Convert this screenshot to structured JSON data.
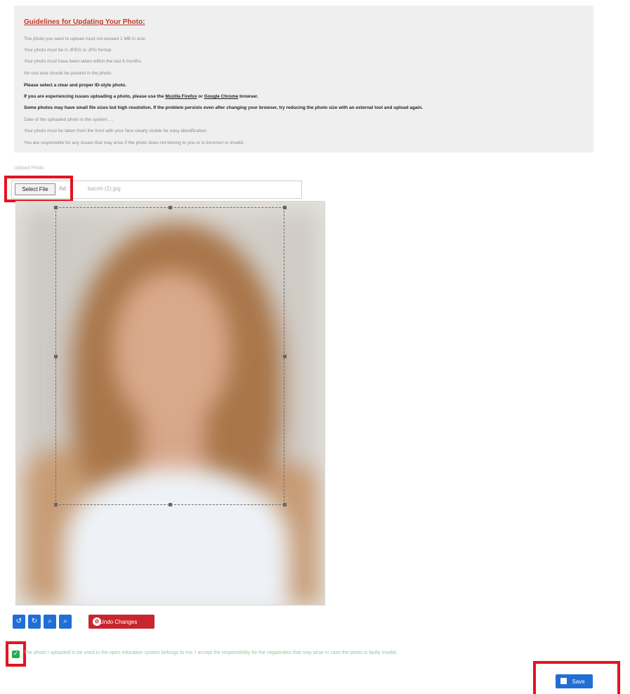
{
  "guidelines": {
    "title": "Guidelines for Updating Your Photo:",
    "items": [
      "The photo you want to upload must not exceed 1 MB in size.",
      "Your photo must be in JPEG or JPG format.",
      "Your photo must have been taken within the last 6 months.",
      "No one else should be present in the photo.",
      "Please select a clear and proper ID-style photo."
    ],
    "browser_note_before": "If you are experiencing issues uploading a photo, please use the ",
    "browser_firefox": "Mozilla Firefox",
    "browser_or": " or ",
    "browser_chrome": "Google Chrome",
    "browser_note_after": " browser.",
    "resolution_note": "Some photos may have small file sizes but high resolution. If the problem persists even after changing your browser, try reducing the photo size with an external tool and upload again.",
    "date_note": "Date of the uploaded photo in the system: ...",
    "front_note": "Your photo must be taken from the front with your face clearly visible for easy identification.",
    "responsibility_note": "You are responsible for any issues that may arise if the photo does not belong to you or is incorrect or invalid."
  },
  "upload": {
    "label": "Upload Photo",
    "select_file_label": "Select File",
    "file_prefix": "Ad",
    "file_name": "bacım (1).jpg"
  },
  "toolbar": {
    "rotate_left_icon": "rotate-left-icon",
    "rotate_right_icon": "rotate-right-icon",
    "zoom_in_icon": "zoom-in-icon",
    "zoom_out_icon": "zoom-out-icon",
    "undo_label": "Undo Changes"
  },
  "consent": {
    "checked": true,
    "text": "The photo I uploaded to be used in the open education system belongs to me. I accept the responsibility for the negativities that may arise in case the photo is faulty invalid."
  },
  "actions": {
    "save_label": "Save"
  },
  "colors": {
    "primary": "#1f6fd6",
    "danger": "#c9252f",
    "highlight": "#e3141f",
    "success": "#2fa84f"
  }
}
